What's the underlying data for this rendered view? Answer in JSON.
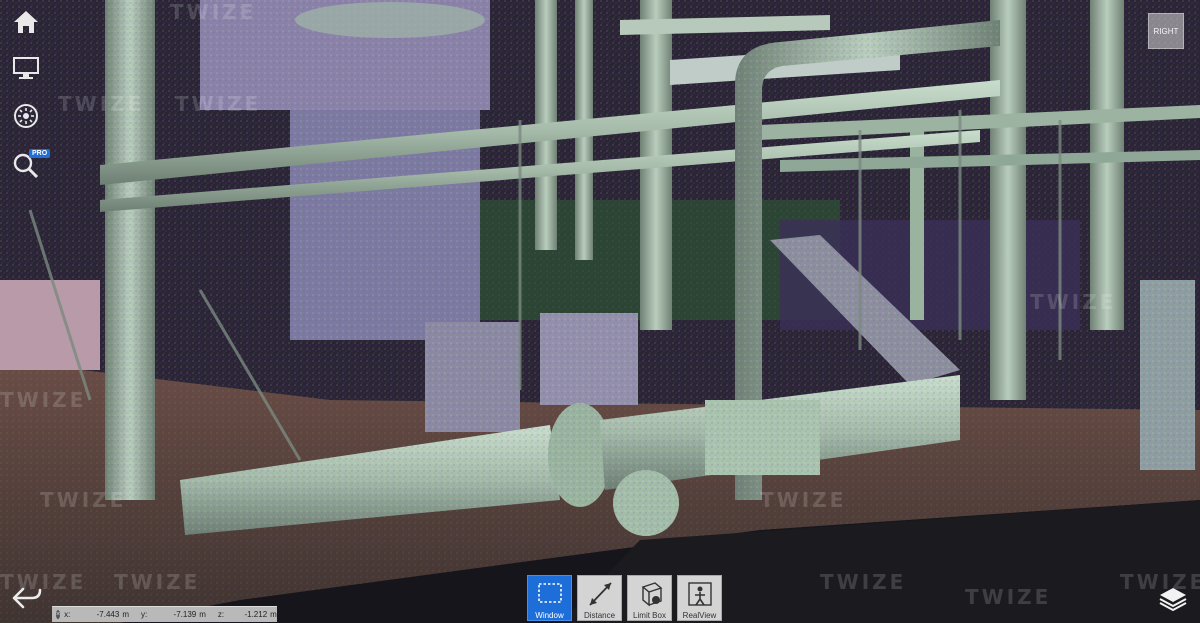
{
  "viewer": {
    "watermark_text": "TWIZE",
    "view_cube_label": "RIGHT",
    "pro_badge": "PRO"
  },
  "sidebar": {
    "items": [
      {
        "name": "home",
        "icon": "home-icon"
      },
      {
        "name": "display",
        "icon": "monitor-icon"
      },
      {
        "name": "lighting",
        "icon": "sun-icon"
      },
      {
        "name": "inspect",
        "icon": "search-icon"
      }
    ]
  },
  "coordinates": {
    "x_label": "x:",
    "x_value": "-7.443",
    "x_unit": "m",
    "y_label": "y:",
    "y_value": "-7.139",
    "y_unit": "m",
    "z_label": "z:",
    "z_value": "-1.212",
    "z_unit": "m"
  },
  "toolbar": {
    "tools": [
      {
        "label": "Window",
        "icon": "selection-window-icon",
        "active": true
      },
      {
        "label": "Distance",
        "icon": "distance-measure-icon",
        "active": false
      },
      {
        "label": "Limit Box",
        "icon": "limit-box-icon",
        "active": false
      },
      {
        "label": "RealView",
        "icon": "realview-icon",
        "active": false
      }
    ]
  },
  "colors": {
    "active_tool": "#1d6ed8",
    "pro_badge": "#1f6fd6",
    "tool_bg": "#d4d4d4",
    "pointcloud_mint": "#9fc7b0",
    "pointcloud_violet": "#8a7ab8",
    "pointcloud_green": "#2f7a3a",
    "ground_brown": "#5a4339"
  }
}
